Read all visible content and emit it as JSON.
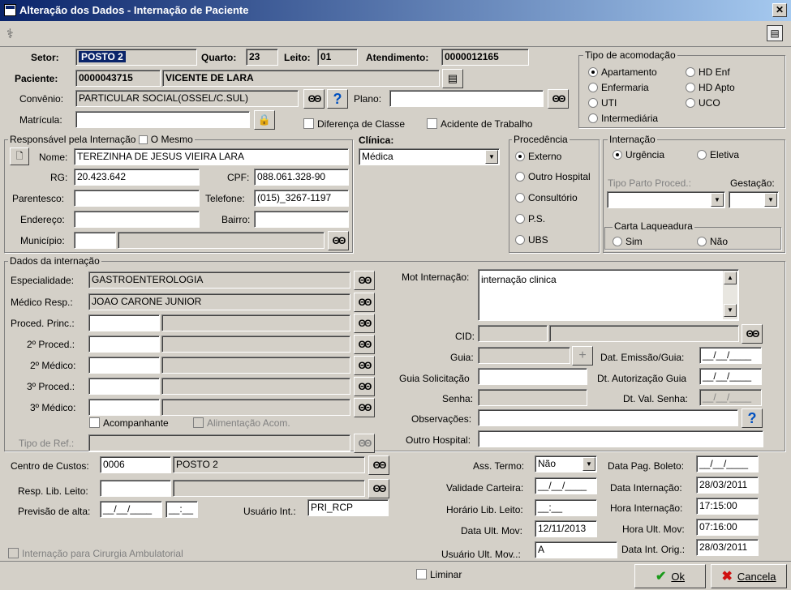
{
  "window": {
    "title": "Alteração dos Dados - Internação de Paciente",
    "close": "✕"
  },
  "icons": {
    "toolbar_left": "patient-icon",
    "toolbar_right": "print-icon",
    "search": "binoculars-icon",
    "help": "help-icon",
    "lookup": "lookup-icon"
  },
  "header": {
    "setor_label": "Setor:",
    "setor_value": "POSTO 2",
    "quarto_label": "Quarto:",
    "quarto_value": "23",
    "leito_label": "Leito:",
    "leito_value": "01",
    "atend_label": "Atendimento:",
    "atend_value": "0000012165",
    "paciente_label": "Paciente:",
    "paciente_id": "0000043715",
    "paciente_nome": "VICENTE DE LARA",
    "convenio_label": "Convênio:",
    "convenio_value": "PARTICULAR SOCIAL(OSSEL/C.SUL)",
    "plano_label": "Plano:",
    "plano_value": "",
    "matricula_label": "Matrícula:",
    "matricula_value": "",
    "dif_classe": "Diferença de Classe",
    "acidente": "Acidente de Trabalho"
  },
  "acomodacao": {
    "title": "Tipo de acomodação",
    "options": [
      "Apartamento",
      "HD Enf",
      "Enfermaria",
      "HD Apto",
      "UTI",
      "UCO",
      "Intermediária"
    ],
    "selected": "Apartamento"
  },
  "responsavel": {
    "title": "Responsável pela Internação",
    "mesmo": "O Mesmo",
    "nome_label": "Nome:",
    "nome_value": "TEREZINHA DE JESUS VIEIRA LARA",
    "rg_label": "RG:",
    "rg_value": "20.423.642",
    "cpf_label": "CPF:",
    "cpf_value": "088.061.328-90",
    "parentesco_label": "Parentesco:",
    "parentesco_value": "",
    "telefone_label": "Telefone:",
    "telefone_value": "(015)_3267-1197",
    "endereco_label": "Endereço:",
    "endereco_value": "",
    "bairro_label": "Bairro:",
    "bairro_value": "",
    "municipio_label": "Município:",
    "municipio_code": "",
    "municipio_name": ""
  },
  "clinica": {
    "label": "Clínica:",
    "value": "Médica"
  },
  "procedencia": {
    "title": "Procedência",
    "options": [
      "Externo",
      "Outro Hospital",
      "Consultório",
      "P.S.",
      "UBS"
    ],
    "selected": "Externo"
  },
  "internacao": {
    "title": "Internação",
    "options": [
      "Urgência",
      "Eletiva"
    ],
    "selected": "Urgência",
    "tipo_parto_label": "Tipo Parto Proced.:",
    "gestacao_label": "Gestação:",
    "laqueadura_title": "Carta Laqueadura",
    "laqueadura_options": [
      "Sim",
      "Não"
    ]
  },
  "dados": {
    "title": "Dados da internação",
    "especialidade_label": "Especialidade:",
    "especialidade_value": "GASTROENTEROLOGIA",
    "medico_label": "Médico Resp.:",
    "medico_value": "JOAO CARONE JUNIOR",
    "proced_princ_label": "Proced. Princ.:",
    "proced2_label": "2º Proced.:",
    "medico2_label": "2º Médico:",
    "proced3_label": "3º Proced.:",
    "medico3_label": "3º Médico:",
    "acompanhante": "Acompanhante",
    "alimentacao": "Alimentação Acom.",
    "tipo_ref_label": "Tipo de Ref.:",
    "mot_label": "Mot Internação:",
    "mot_value": "internação clinica",
    "cid_label": "CID:",
    "guia_label": "Guia:",
    "dat_emissao_label": "Dat. Emissão/Guia:",
    "dat_emissao_value": "__/__/____",
    "guia_sol_label": "Guia Solicitação",
    "dt_aut_label": "Dt. Autorização Guia",
    "dt_aut_value": "__/__/____",
    "senha_label": "Senha:",
    "dt_val_label": "Dt. Val. Senha:",
    "dt_val_value": "__/__/____",
    "obs_label": "Observações:",
    "outro_hosp_label": "Outro Hospital:"
  },
  "bottom": {
    "centro_label": "Centro de Custos:",
    "centro_code": "0006",
    "centro_name": "POSTO 2",
    "resp_lib_label": "Resp. Lib. Leito:",
    "previsao_label": "Previsão de alta:",
    "previsao_date": "__/__/____",
    "previsao_time": "__:__",
    "usuario_int_label": "Usuário Int.:",
    "usuario_int_value": "PRI_RCP",
    "ass_termo_label": "Ass. Termo:",
    "ass_termo_value": "Não",
    "validade_label": "Validade Carteira:",
    "validade_value": "__/__/____",
    "horario_lib_label": "Horário Lib. Leito:",
    "horario_lib_value": "__:__",
    "data_ult_label": "Data Ult. Mov:",
    "data_ult_value": "12/11/2013",
    "usuario_ult_label": "Usuário Ult. Mov..:",
    "usuario_ult_value": "A",
    "data_pag_label": "Data Pag. Boleto:",
    "data_pag_value": "__/__/____",
    "data_int_label": "Data Internação:",
    "data_int_value": "28/03/2011",
    "hora_int_label": "Hora Internação:",
    "hora_int_value": "17:15:00",
    "hora_ult_label": "Hora Ult. Mov:",
    "hora_ult_value": "07:16:00",
    "data_orig_label": "Data Int. Orig.:",
    "data_orig_value": "28/03/2011",
    "cirurgia_amb": "Internação para Cirurgia Ambulatorial",
    "liminar": "Liminar",
    "ok": "Ok",
    "cancela": "Cancela"
  }
}
